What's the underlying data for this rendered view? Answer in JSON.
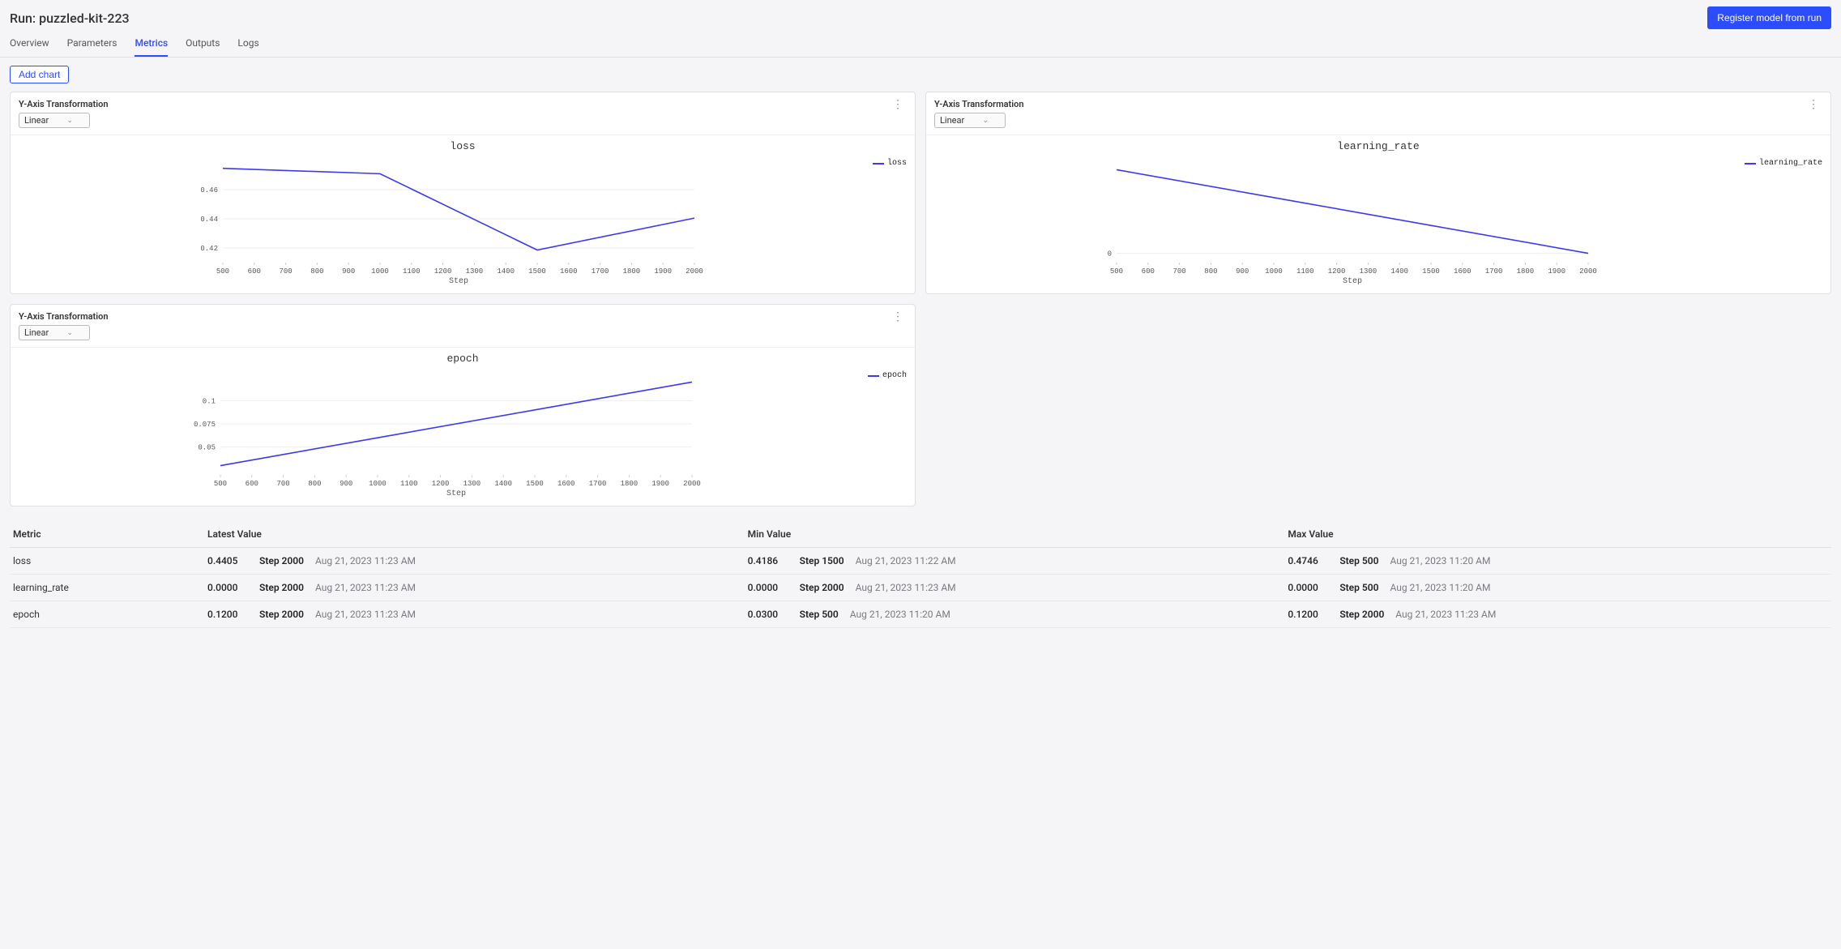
{
  "header": {
    "title": "Run: puzzled-kit-223",
    "register_button": "Register model from run"
  },
  "tabs": {
    "items": [
      "Overview",
      "Parameters",
      "Metrics",
      "Outputs",
      "Logs"
    ],
    "active": "Metrics"
  },
  "toolbar": {
    "add_chart": "Add chart"
  },
  "yaxis": {
    "label": "Y-Axis Transformation",
    "value": "Linear"
  },
  "chart_data": [
    {
      "type": "line",
      "title": "loss",
      "xlabel": "Step",
      "ylabel": "",
      "legend": [
        "loss"
      ],
      "x": [
        500,
        1000,
        1500,
        2000
      ],
      "series": [
        {
          "name": "loss",
          "values": [
            0.4746,
            0.4709,
            0.4186,
            0.4405
          ]
        }
      ],
      "xlim": [
        500,
        2000
      ],
      "ylim": [
        0.41,
        0.48
      ],
      "yticks": [
        0.42,
        0.44,
        0.46
      ],
      "xticks": [
        500,
        600,
        700,
        800,
        900,
        1000,
        1100,
        1200,
        1300,
        1400,
        1500,
        1600,
        1700,
        1800,
        1900,
        2000
      ]
    },
    {
      "type": "line",
      "title": "learning_rate",
      "xlabel": "Step",
      "ylabel": "",
      "legend": [
        "learning_rate"
      ],
      "x": [
        500,
        1000,
        1500,
        2000
      ],
      "series": [
        {
          "name": "learning_rate",
          "values": [
            4.5e-05,
            3e-05,
            1.5e-05,
            0.0
          ]
        }
      ],
      "xlim": [
        500,
        2000
      ],
      "ylim": [
        -5e-06,
        5e-05
      ],
      "yticks": [
        0
      ],
      "xticks": [
        500,
        600,
        700,
        800,
        900,
        1000,
        1100,
        1200,
        1300,
        1400,
        1500,
        1600,
        1700,
        1800,
        1900,
        2000
      ]
    },
    {
      "type": "line",
      "title": "epoch",
      "xlabel": "Step",
      "ylabel": "",
      "legend": [
        "epoch"
      ],
      "x": [
        500,
        1000,
        1500,
        2000
      ],
      "series": [
        {
          "name": "epoch",
          "values": [
            0.03,
            0.06,
            0.09,
            0.12
          ]
        }
      ],
      "xlim": [
        500,
        2000
      ],
      "ylim": [
        0.02,
        0.13
      ],
      "yticks": [
        0.05,
        0.075,
        0.1
      ],
      "xticks": [
        500,
        600,
        700,
        800,
        900,
        1000,
        1100,
        1200,
        1300,
        1400,
        1500,
        1600,
        1700,
        1800,
        1900,
        2000
      ]
    }
  ],
  "table": {
    "headers": [
      "Metric",
      "Latest Value",
      "Min Value",
      "Max Value"
    ],
    "rows": [
      {
        "metric": "loss",
        "latest": {
          "value": "0.4405",
          "step": "Step 2000",
          "ts": "Aug 21, 2023 11:23 AM"
        },
        "min": {
          "value": "0.4186",
          "step": "Step 1500",
          "ts": "Aug 21, 2023 11:22 AM"
        },
        "max": {
          "value": "0.4746",
          "step": "Step 500",
          "ts": "Aug 21, 2023 11:20 AM"
        }
      },
      {
        "metric": "learning_rate",
        "latest": {
          "value": "0.0000",
          "step": "Step 2000",
          "ts": "Aug 21, 2023 11:23 AM"
        },
        "min": {
          "value": "0.0000",
          "step": "Step 2000",
          "ts": "Aug 21, 2023 11:23 AM"
        },
        "max": {
          "value": "0.0000",
          "step": "Step 500",
          "ts": "Aug 21, 2023 11:20 AM"
        }
      },
      {
        "metric": "epoch",
        "latest": {
          "value": "0.1200",
          "step": "Step 2000",
          "ts": "Aug 21, 2023 11:23 AM"
        },
        "min": {
          "value": "0.0300",
          "step": "Step 500",
          "ts": "Aug 21, 2023 11:20 AM"
        },
        "max": {
          "value": "0.1200",
          "step": "Step 2000",
          "ts": "Aug 21, 2023 11:23 AM"
        }
      }
    ]
  }
}
